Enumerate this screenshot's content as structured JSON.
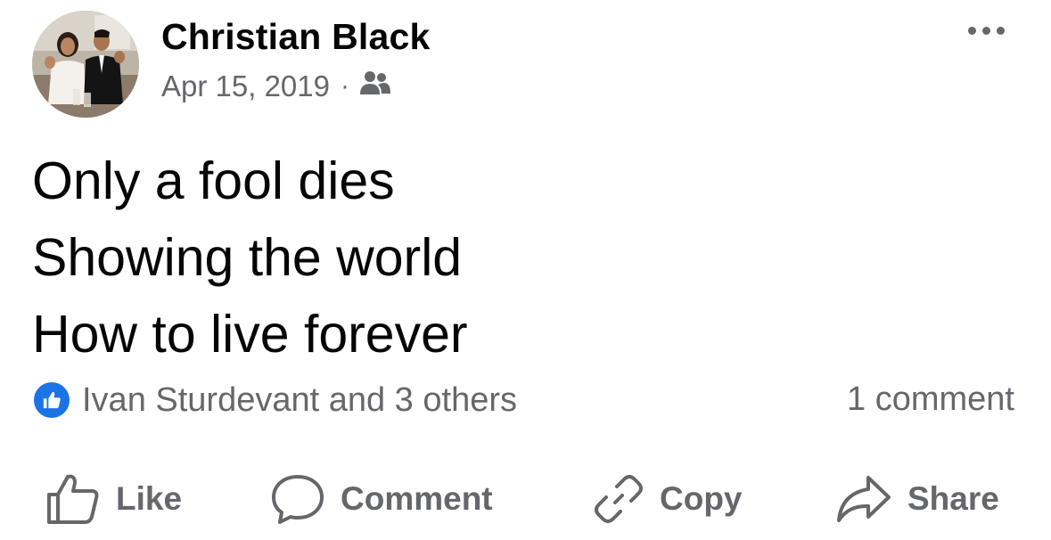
{
  "post": {
    "author": "Christian Black",
    "date": "Apr 15, 2019",
    "separator": "·",
    "audience_icon": "friends-icon",
    "lines": [
      "Only a fool dies",
      "Showing the world",
      "How to live forever"
    ]
  },
  "reactions": {
    "icon": "like-reaction-icon",
    "summary": "Ivan Sturdevant and 3 others",
    "comments": "1 comment"
  },
  "actions": {
    "like": "Like",
    "comment": "Comment",
    "copy": "Copy",
    "share": "Share"
  },
  "colors": {
    "text_primary": "#050505",
    "text_secondary": "#65676b",
    "like_blue": "#1b74e4"
  }
}
